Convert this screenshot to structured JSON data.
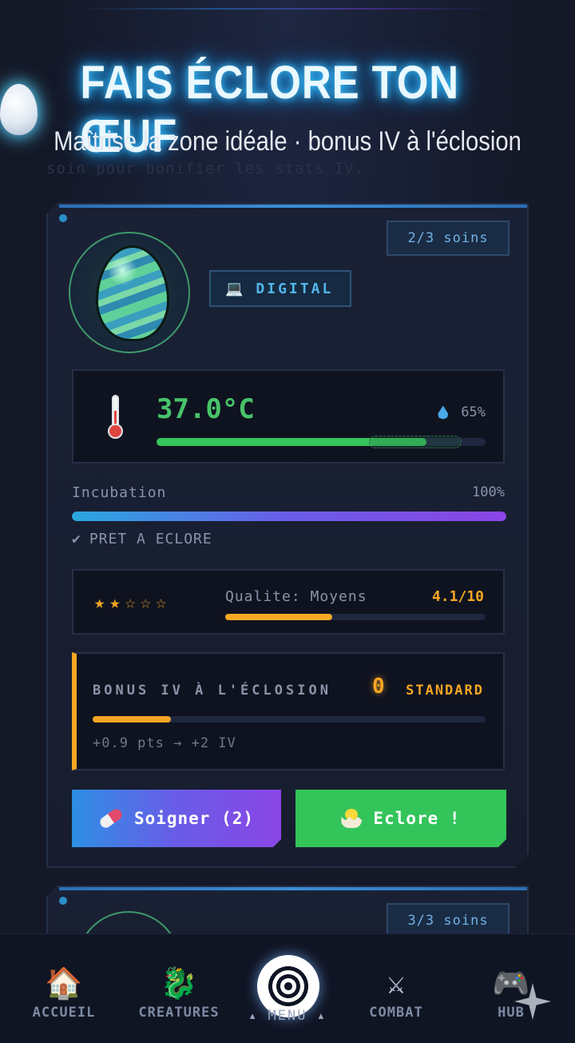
{
  "header": {
    "title": "FAIS ÉCLORE TON ŒUF",
    "subtitle": "Maîtrise la zone idéale · bonus IV à l'éclosion",
    "ghost_text": "soin pour bonifier les stats IV."
  },
  "eggs": [
    {
      "care_count": "2/3 soins",
      "type_icon": "laptop-icon",
      "type_label": "DIGITAL",
      "temperature": "37.0°C",
      "temperature_fraction": 0.82,
      "humidity": "65%",
      "incubation_label": "Incubation",
      "incubation_pct": "100%",
      "incubation_fraction": 1.0,
      "status": "PRET A ECLORE",
      "status_icon": "✔",
      "stars": [
        "★",
        "★",
        "☆",
        "☆",
        "☆"
      ],
      "quality_label": "Qualite: Moyens",
      "quality_score": "4.1/10",
      "quality_fraction": 0.41,
      "bonus_title": "BONUS IV À L'ÉCLOSION",
      "bonus_value": "0",
      "bonus_rank": "STANDARD",
      "bonus_fraction": 0.2,
      "bonus_detail": "+0.9 pts → +2 IV",
      "heal_button": "Soigner (2)",
      "hatch_button": "Eclore !"
    },
    {
      "care_count": "3/3 soins"
    }
  ],
  "nav": {
    "home": "ACCUEIL",
    "creatures": "CREATURES",
    "menu": "▴ MENU ▴",
    "combat": "COMBAT",
    "hub": "HUB"
  },
  "colors": {
    "accent_green": "#36c45c",
    "accent_orange": "#f6a623",
    "accent_blue": "#2a8ec9",
    "accent_purple": "#8b45e6"
  }
}
